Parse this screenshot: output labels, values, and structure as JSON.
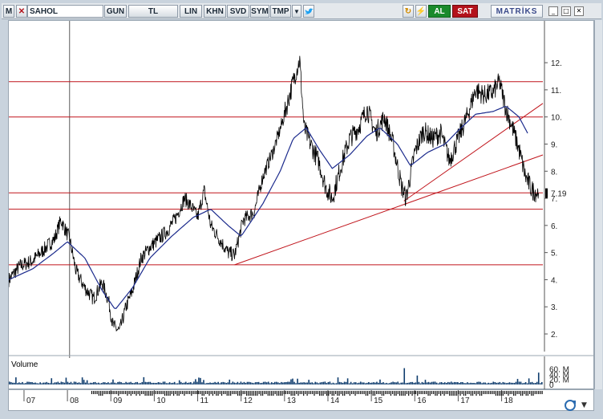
{
  "toolbar": {
    "logo_letter": "M",
    "symbol": "SAHOL",
    "period": "GUN",
    "currency": "TL",
    "scale": "LIN",
    "buttons": [
      "KHN",
      "SVD",
      "SYM",
      "TMP"
    ],
    "buy_label": "AL",
    "sell_label": "SAT",
    "brand": "MATRİKS"
  },
  "colors": {
    "price": "#000000",
    "moving_average": "#1b2a8c",
    "levels": "#c0141b",
    "volume": "#0f3d6e",
    "buy": "#1a8a2c",
    "sell": "#b3121b"
  },
  "chart_data": {
    "type": "line",
    "x_tick_labels": [
      "07",
      "08",
      "09",
      "10",
      "11",
      "12",
      "13",
      "14",
      "15",
      "16",
      "17",
      "18"
    ],
    "x_years": [
      2007,
      2008,
      2009,
      2010,
      2011,
      2012,
      2013,
      2014,
      2015,
      2016,
      2017,
      2018
    ],
    "x_range": [
      2006.65,
      2018.95
    ],
    "y_ticks": [
      2,
      3,
      4,
      5,
      6,
      7,
      8,
      9,
      10,
      11,
      12
    ],
    "y_tick_labels": [
      "2.",
      "3.",
      "4.",
      "5.",
      "6.",
      "7.",
      "8.",
      "9.",
      "10.",
      "11.",
      "12."
    ],
    "ylim": [
      1.35,
      12.95
    ],
    "last_price_label": "7.19",
    "last_price": 7.19,
    "horizontal_levels": [
      11.3,
      10.0,
      7.2,
      6.6,
      4.55
    ],
    "trendlines": [
      {
        "x": [
          2011.85,
          2018.95
        ],
        "y": [
          4.55,
          8.6
        ]
      },
      {
        "x": [
          2015.75,
          2018.95
        ],
        "y": [
          6.9,
          10.5
        ]
      }
    ],
    "price_anchors": {
      "x": [
        2006.65,
        2006.9,
        2007.2,
        2007.45,
        2007.7,
        2007.85,
        2008.05,
        2008.2,
        2008.4,
        2008.6,
        2008.8,
        2008.95,
        2009.05,
        2009.2,
        2009.35,
        2009.5,
        2009.7,
        2009.9,
        2010.1,
        2010.3,
        2010.5,
        2010.7,
        2010.85,
        2011.0,
        2011.15,
        2011.3,
        2011.5,
        2011.7,
        2011.85,
        2012.05,
        2012.3,
        2012.5,
        2012.75,
        2012.95,
        2013.1,
        2013.25,
        2013.35,
        2013.45,
        2013.6,
        2013.8,
        2013.95,
        2014.1,
        2014.3,
        2014.5,
        2014.7,
        2014.9,
        2015.1,
        2015.3,
        2015.5,
        2015.7,
        2015.8,
        2016.0,
        2016.2,
        2016.4,
        2016.6,
        2016.8,
        2017.0,
        2017.2,
        2017.4,
        2017.6,
        2017.8,
        2017.95,
        2018.1,
        2018.25,
        2018.4,
        2018.55,
        2018.7,
        2018.85
      ],
      "y": [
        4.0,
        4.5,
        4.7,
        5.1,
        5.5,
        6.2,
        5.5,
        4.3,
        3.7,
        3.3,
        3.9,
        3.2,
        2.3,
        2.1,
        3.0,
        3.6,
        4.8,
        5.2,
        5.5,
        5.8,
        6.3,
        7.0,
        6.7,
        6.3,
        7.3,
        6.0,
        5.5,
        5.0,
        4.9,
        6.2,
        6.5,
        7.8,
        8.8,
        9.8,
        10.7,
        11.6,
        12.1,
        9.6,
        9.0,
        8.3,
        7.4,
        7.0,
        8.2,
        9.2,
        9.6,
        10.3,
        9.4,
        10.0,
        9.0,
        7.4,
        7.0,
        8.7,
        9.5,
        9.2,
        9.4,
        8.4,
        9.2,
        10.0,
        11.0,
        10.8,
        10.9,
        11.3,
        10.3,
        9.6,
        8.8,
        7.8,
        7.3,
        7.19
      ]
    },
    "moving_average_anchors": {
      "x": [
        2006.65,
        2007.2,
        2007.7,
        2008.0,
        2008.4,
        2008.8,
        2009.1,
        2009.5,
        2009.9,
        2010.4,
        2010.9,
        2011.3,
        2011.7,
        2012.0,
        2012.5,
        2012.9,
        2013.2,
        2013.5,
        2013.8,
        2014.1,
        2014.5,
        2014.9,
        2015.2,
        2015.6,
        2015.9,
        2016.3,
        2016.7,
        2017.0,
        2017.4,
        2017.8,
        2018.1,
        2018.4,
        2018.6
      ],
      "y": [
        4.0,
        4.4,
        5.0,
        5.4,
        4.8,
        3.6,
        2.9,
        3.7,
        4.8,
        5.6,
        6.3,
        6.6,
        6.0,
        5.6,
        6.8,
        8.0,
        9.2,
        9.6,
        8.8,
        8.1,
        8.6,
        9.3,
        9.6,
        9.0,
        8.2,
        8.7,
        9.0,
        9.5,
        10.1,
        10.2,
        10.4,
        10.0,
        9.4
      ]
    },
    "volume": {
      "title": "Volume",
      "y_tick_labels": [
        "60. M",
        "40. M",
        "20. M",
        "0"
      ],
      "ylim": [
        0,
        70
      ],
      "spikes": [
        {
          "x": 2008.05,
          "y": 10
        },
        {
          "x": 2009.05,
          "y": 19
        },
        {
          "x": 2010.55,
          "y": 16
        },
        {
          "x": 2011.0,
          "y": 15
        },
        {
          "x": 2013.3,
          "y": 22
        },
        {
          "x": 2015.75,
          "y": 62
        },
        {
          "x": 2016.05,
          "y": 34
        },
        {
          "x": 2018.85,
          "y": 45
        }
      ]
    }
  }
}
